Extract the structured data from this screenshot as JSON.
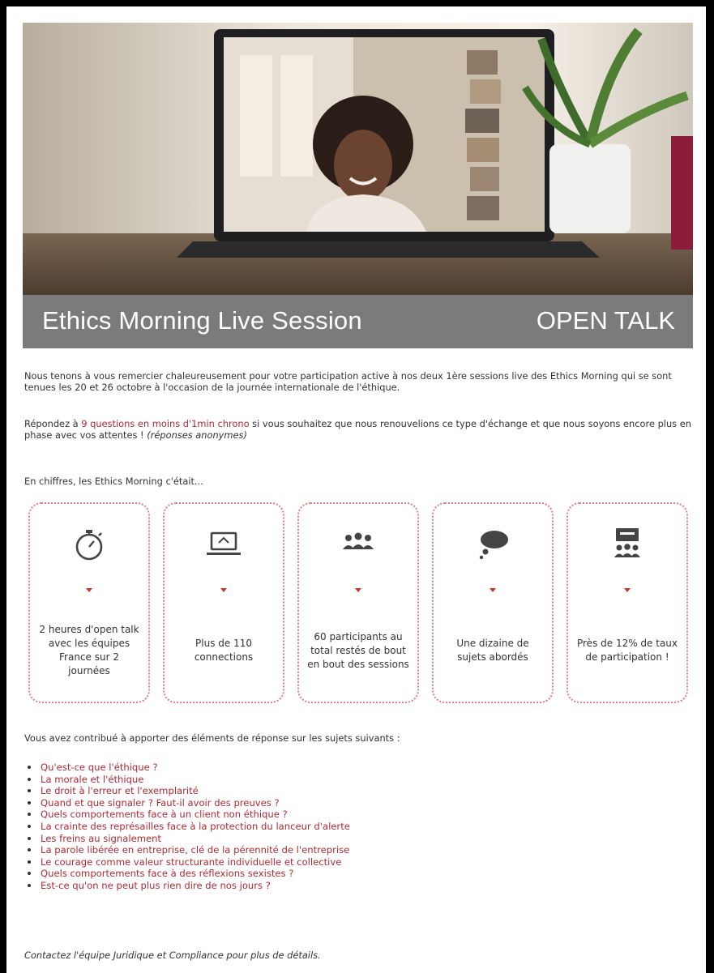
{
  "banner": {
    "title": "Ethics Morning Live Session",
    "tag": "OPEN TALK"
  },
  "intro": {
    "thanks": "Nous tenons à vous remercier chaleureusement pour votre participation active à nos deux 1ère sessions live des Ethics Morning qui se sont tenues les 20 et 26 octobre à l'occasion de la journée internationale de l'éthique.",
    "survey_before": "Répondez à ",
    "survey_highlight": "9 questions en moins d'1min chrono",
    "survey_after": " si vous souhaitez que nous renouvelions ce type d'échange et que nous soyons encore plus en phase avec vos attentes ! ",
    "survey_note": "(réponses anonymes)",
    "figures_intro": "En chiffres, les Ethics Morning c'était..."
  },
  "stats": [
    {
      "icon": "stopwatch-icon",
      "text": "2 heures d'open talk avec les équipes France sur 2 journées"
    },
    {
      "icon": "laptop-icon",
      "text": "Plus de 110 connections"
    },
    {
      "icon": "people-group-icon",
      "text": "60 participants au total restés de bout en bout des sessions"
    },
    {
      "icon": "thought-bubble-icon",
      "text": "Une dizaine de sujets abordés"
    },
    {
      "icon": "presentation-audience-icon",
      "text": "Près de 12% de taux de participation !"
    }
  ],
  "topics_intro": "Vous avez contribué à apporter des éléments de réponse sur les sujets suivants :",
  "topics": [
    "Qu'est-ce que l'éthique ?",
    "La morale et l'éthique",
    "Le droit à l'erreur et l'exemplarité",
    "Quand et que signaler ? Faut-il avoir des preuves ?",
    "Quels comportements face à un client non éthique ?",
    "La crainte des représailles face à la protection du lanceur d'alerte",
    "Les freins au signalement",
    "La parole libérée en entreprise, clé de la pérennité de l'entreprise",
    "Le courage comme valeur structurante individuelle et collective",
    "Quels comportements face à des réflexions sexistes ?",
    "Est-ce qu'on ne peut plus rien dire de nos jours ?"
  ],
  "footer": "Contactez l'équipe Juridique et Compliance pour plus de détails.",
  "colors": {
    "accent": "#b02a36",
    "banner_bg": "#7b7b7b",
    "card_border": "#e07d88"
  }
}
